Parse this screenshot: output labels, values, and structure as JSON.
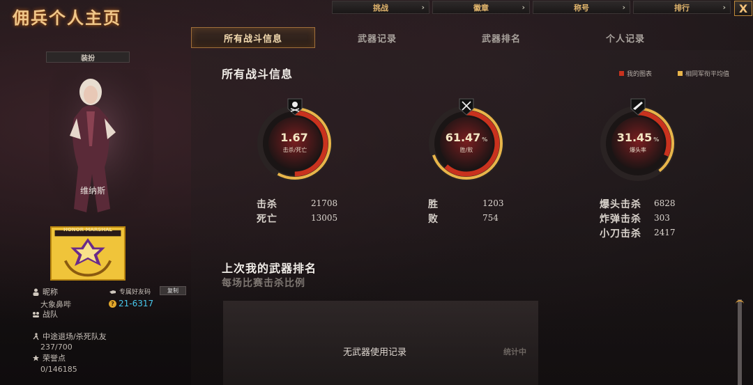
{
  "window": {
    "title": "佣兵个人主页",
    "close_label": "X"
  },
  "topnav": [
    {
      "label": "挑战"
    },
    {
      "label": "徽章"
    },
    {
      "label": "称号"
    },
    {
      "label": "排行"
    }
  ],
  "tabs": [
    {
      "label": "所有战斗信息",
      "active": true
    },
    {
      "label": "武器记录",
      "active": false
    },
    {
      "label": "武器排名",
      "active": false
    },
    {
      "label": "个人记录",
      "active": false
    }
  ],
  "profile": {
    "dress_button": "装扮",
    "character_name": "维纳斯",
    "badge_text": "HONOR MARSHAL",
    "nickname_label": "昵称",
    "nickname_value": "大象鼻哔",
    "friend_code_label": "专属好友码",
    "copy_button": "复制",
    "friend_code": "21-6317",
    "team_label": "战队",
    "quit_label": "中途退场/杀死队友",
    "quit_value": "237/700",
    "honor_label": "荣誉点",
    "honor_value": "0/146185"
  },
  "battle": {
    "title": "所有战斗信息",
    "legend_mine": "我的图表",
    "legend_avg": "相同军衔平均值",
    "rings": [
      {
        "value": "1.67",
        "pct": "",
        "caption": "击杀/死亡",
        "icon": "skull-crossbones-icon",
        "fraction": 0.5
      },
      {
        "value": "61.47",
        "pct": "%",
        "caption": "胜/败",
        "icon": "crossed-swords-icon",
        "fraction": 0.6147
      },
      {
        "value": "31.45",
        "pct": "%",
        "caption": "爆头率",
        "icon": "rifle-icon",
        "fraction": 0.3145
      }
    ],
    "stats_col1": [
      {
        "label": "击杀",
        "value": "21708"
      },
      {
        "label": "死亡",
        "value": "13005"
      }
    ],
    "stats_col2": [
      {
        "label": "胜",
        "value": "1203"
      },
      {
        "label": "败",
        "value": "754"
      }
    ],
    "stats_col3": [
      {
        "label": "爆头击杀",
        "value": "6828"
      },
      {
        "label": "炸弹击杀",
        "value": "303"
      },
      {
        "label": "小刀击杀",
        "value": "2417"
      }
    ]
  },
  "weapons": {
    "title": "上次我的武器排名",
    "subtitle": "每场比赛击杀比例",
    "empty_text": "无武器使用记录",
    "stats_label": "统计中"
  },
  "colors": {
    "accent": "#e2b66d",
    "ring_red": "#c8321e",
    "ring_gold": "#e8b54a",
    "friend_code": "#48c8ee"
  }
}
